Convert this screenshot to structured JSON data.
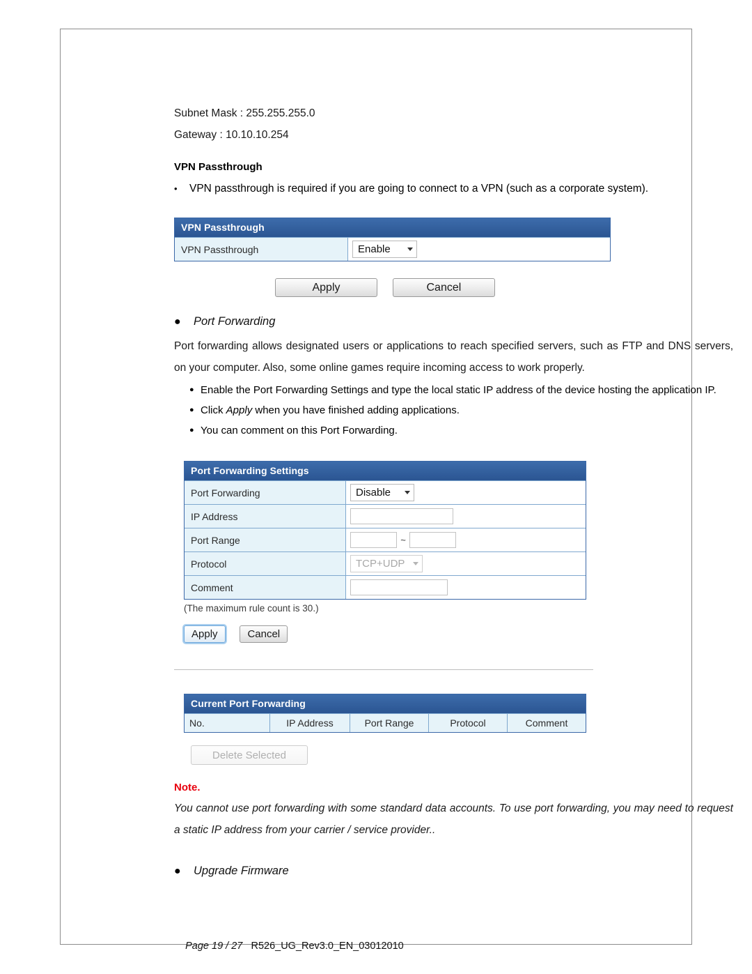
{
  "document": {
    "network_lines": [
      "Subnet Mask : 255.255.255.0",
      "Gateway : 10.10.10.254"
    ],
    "vpn_heading": "VPN Passthrough",
    "vpn_bullet": "VPN passthrough is required if you are going to connect to a VPN (such as a corporate system).",
    "port_forwarding_section_title": "Port Forwarding",
    "port_forwarding_paragraph": "Port forwarding allows designated users or applications to reach specified servers, such as FTP and DNS servers, on your computer. Also, some online games require incoming access to work properly.",
    "port_forwarding_bullets": [
      "Enable the Port Forwarding Settings and type the local static IP address of the device hosting the application IP.",
      "Click Apply when you have finished adding applications.",
      "You can comment on this Port Forwarding."
    ],
    "bullet_2_prefix": "Click ",
    "bullet_2_italic": "Apply",
    "bullet_2_suffix": " when you have finished adding applications.",
    "note_title": "Note.",
    "note_body": "You cannot use port forwarding with some standard data accounts. To use port forwarding, you may need to request a static IP address from your carrier / service provider..",
    "upgrade_firmware_section_title": "Upgrade Firmware",
    "bullet_glyph": "●",
    "small_bullet_glyph": "●",
    "footer_page": "Page 19 / 27",
    "footer_doc": "R526_UG_Rev3.0_EN_03012010"
  },
  "vpn_panel": {
    "header": "VPN Passthrough",
    "row_label": "VPN Passthrough",
    "select_value": "Enable",
    "apply_label": "Apply",
    "cancel_label": "Cancel"
  },
  "port_forwarding_panel": {
    "header": "Port Forwarding Settings",
    "rows": [
      {
        "label": "Port Forwarding",
        "type": "select",
        "value": "Disable",
        "disabled": false
      },
      {
        "label": "IP Address",
        "type": "text",
        "value": ""
      },
      {
        "label": "Port Range",
        "type": "range",
        "value": "",
        "value2": "",
        "separator": "~"
      },
      {
        "label": "Protocol",
        "type": "select",
        "value": "TCP+UDP",
        "disabled": true
      },
      {
        "label": "Comment",
        "type": "text",
        "value": ""
      }
    ],
    "max_rule_note": "(The maximum rule count is 30.)",
    "apply_label": "Apply",
    "cancel_label": "Cancel"
  },
  "current_port_forwarding": {
    "header": "Current Port Forwarding",
    "columns": [
      "No.",
      "IP Address",
      "Port Range",
      "Protocol",
      "Comment"
    ],
    "rows": [],
    "delete_label": "Delete Selected"
  },
  "colors": {
    "panel_header_blue": "#2f5e9e",
    "panel_border_blue": "#3b68a8",
    "label_cell_cyan": "#e6f3f9",
    "note_red": "#e8000d",
    "page_border_gray": "#8c8c8c"
  }
}
